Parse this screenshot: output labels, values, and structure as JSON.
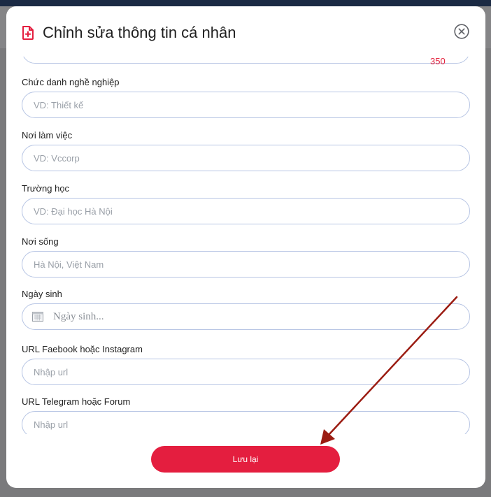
{
  "modal": {
    "title": "Chỉnh sửa thông tin cá nhân",
    "title_icon": "document-plus-icon",
    "close_icon": "close-circle-icon"
  },
  "previous_field": {
    "char_counter": "350"
  },
  "fields": [
    {
      "label": "Chức danh nghề nghiệp",
      "placeholder": "VD: Thiết kế"
    },
    {
      "label": "Nơi làm việc",
      "placeholder": "VD: Vccorp"
    },
    {
      "label": "Trường học",
      "placeholder": "VD: Đại học Hà Nội"
    },
    {
      "label": "Nơi sống",
      "placeholder": "Hà Nội, Việt Nam"
    },
    {
      "label": "Ngày sinh",
      "placeholder": "Ngày sinh..."
    },
    {
      "label": "URL Faebook hoặc Instagram",
      "placeholder": "Nhập url"
    },
    {
      "label": "URL Telegram hoặc Forum",
      "placeholder": "Nhập url"
    }
  ],
  "save_button": {
    "label": "Lưu lại"
  },
  "colors": {
    "accent": "#e41e3f",
    "field_border": "#b7c5e4",
    "annotation_arrow": "#9b1c12"
  }
}
